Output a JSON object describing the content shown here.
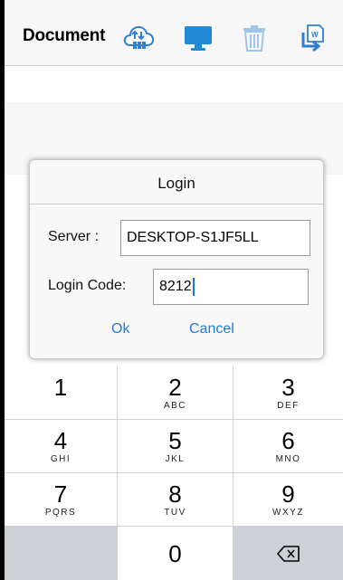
{
  "toolbar": {
    "title": "Document",
    "icons": [
      {
        "name": "cloud-sync-icon",
        "color": "#2e7fd6"
      },
      {
        "name": "monitor-icon",
        "color": "#1f8ad6"
      },
      {
        "name": "trash-icon",
        "color": "#9fc6ea"
      },
      {
        "name": "export-document-icon",
        "color": "#2e7fd6"
      }
    ]
  },
  "dialog": {
    "title": "Login",
    "server_label": "Server :",
    "server_value": "DESKTOP-S1JF5LL",
    "code_label": "Login Code:",
    "code_value": "8212",
    "ok_label": "Ok",
    "cancel_label": "Cancel",
    "accent_color": "#1e7be0"
  },
  "keypad": {
    "keys": [
      {
        "digit": "1",
        "letters": ""
      },
      {
        "digit": "2",
        "letters": "ABC"
      },
      {
        "digit": "3",
        "letters": "DEF"
      },
      {
        "digit": "4",
        "letters": "GHI"
      },
      {
        "digit": "5",
        "letters": "JKL"
      },
      {
        "digit": "6",
        "letters": "MNO"
      },
      {
        "digit": "7",
        "letters": "PQRS"
      },
      {
        "digit": "8",
        "letters": "TUV"
      },
      {
        "digit": "9",
        "letters": "WXYZ"
      },
      {
        "digit": "0",
        "letters": ""
      }
    ],
    "backspace_icon": "backspace-icon"
  }
}
